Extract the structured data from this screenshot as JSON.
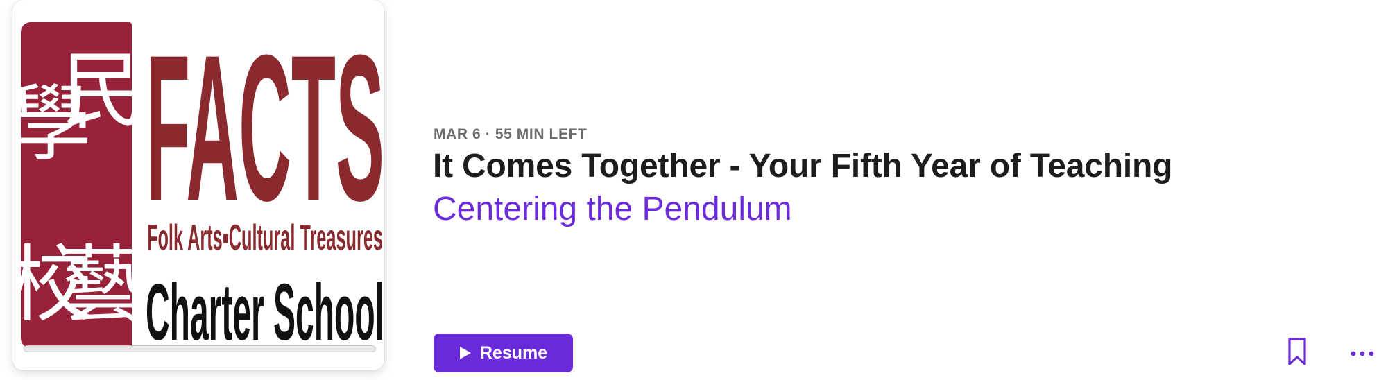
{
  "episode": {
    "date": "MAR 6",
    "separator": "·",
    "time_left": "55 MIN LEFT",
    "title": "It Comes Together - Your Fifth Year of Teaching",
    "show_name": "Centering the Pendulum",
    "progress_fraction": 0.0
  },
  "artwork": {
    "seal_chars": [
      "民",
      "學",
      "藝",
      "校"
    ],
    "logo_text": "FACTS",
    "tagline": "Folk Arts▪Cultural Treasures",
    "school_text": "Charter School",
    "logo_color": "#8b2a2e",
    "seal_color": "#98223a"
  },
  "actions": {
    "resume_label": "Resume",
    "play_icon": "play-icon",
    "bookmark_icon": "bookmark-icon",
    "more_icon": "more-icon"
  },
  "colors": {
    "accent": "#6c2bd9",
    "title": "#1d1d1f",
    "meta": "#6b6b6b"
  }
}
